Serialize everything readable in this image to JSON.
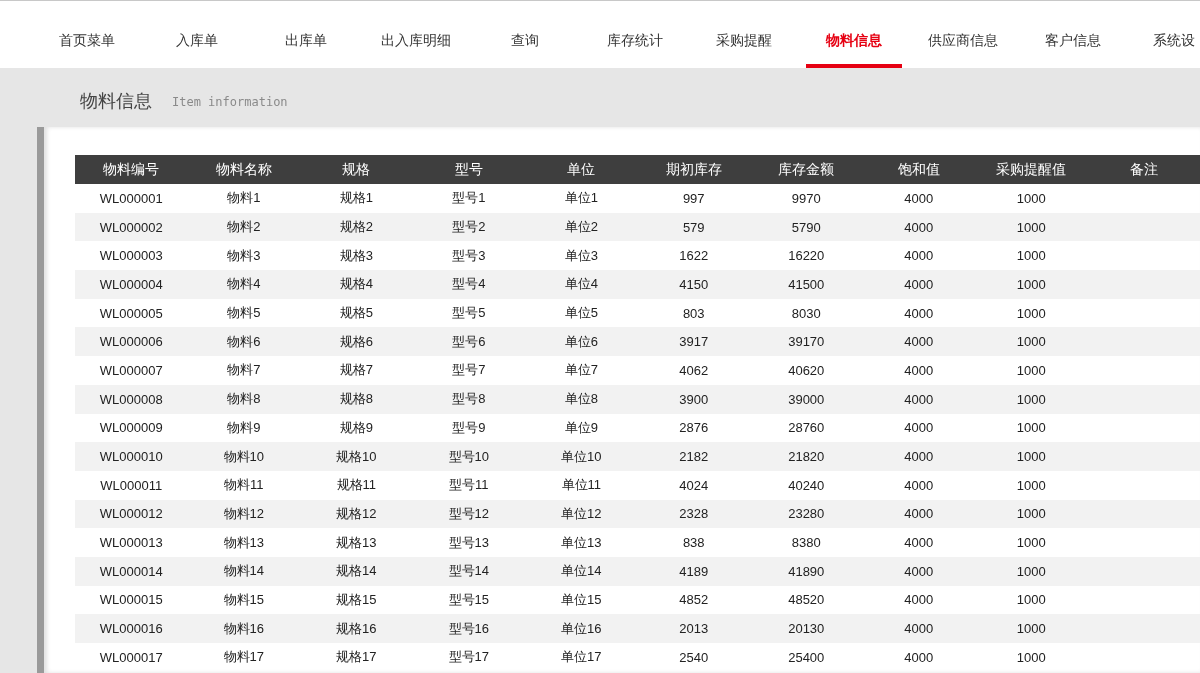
{
  "nav": {
    "items": [
      {
        "label": "首页菜单",
        "selected": false
      },
      {
        "label": "入库单",
        "selected": false
      },
      {
        "label": "出库单",
        "selected": false
      },
      {
        "label": "出入库明细",
        "selected": false
      },
      {
        "label": "查询",
        "selected": false
      },
      {
        "label": "库存统计",
        "selected": false
      },
      {
        "label": "采购提醒",
        "selected": false
      },
      {
        "label": "物料信息",
        "selected": true
      },
      {
        "label": "供应商信息",
        "selected": false
      },
      {
        "label": "客户信息",
        "selected": false
      },
      {
        "label": "系统设",
        "selected": false
      }
    ]
  },
  "page_header": {
    "title": "物料信息",
    "subtitle": "Item information"
  },
  "table": {
    "columns": [
      "物料编号",
      "物料名称",
      "规格",
      "型号",
      "单位",
      "期初库存",
      "库存金额",
      "饱和值",
      "采购提醒值",
      "备注"
    ],
    "rows": [
      [
        "WL000001",
        "物料1",
        "规格1",
        "型号1",
        "单位1",
        "997",
        "9970",
        "4000",
        "1000"
      ],
      [
        "WL000002",
        "物料2",
        "规格2",
        "型号2",
        "单位2",
        "579",
        "5790",
        "4000",
        "1000"
      ],
      [
        "WL000003",
        "物料3",
        "规格3",
        "型号3",
        "单位3",
        "1622",
        "16220",
        "4000",
        "1000"
      ],
      [
        "WL000004",
        "物料4",
        "规格4",
        "型号4",
        "单位4",
        "4150",
        "41500",
        "4000",
        "1000"
      ],
      [
        "WL000005",
        "物料5",
        "规格5",
        "型号5",
        "单位5",
        "803",
        "8030",
        "4000",
        "1000"
      ],
      [
        "WL000006",
        "物料6",
        "规格6",
        "型号6",
        "单位6",
        "3917",
        "39170",
        "4000",
        "1000"
      ],
      [
        "WL000007",
        "物料7",
        "规格7",
        "型号7",
        "单位7",
        "4062",
        "40620",
        "4000",
        "1000"
      ],
      [
        "WL000008",
        "物料8",
        "规格8",
        "型号8",
        "单位8",
        "3900",
        "39000",
        "4000",
        "1000"
      ],
      [
        "WL000009",
        "物料9",
        "规格9",
        "型号9",
        "单位9",
        "2876",
        "28760",
        "4000",
        "1000"
      ],
      [
        "WL000010",
        "物料10",
        "规格10",
        "型号10",
        "单位10",
        "2182",
        "21820",
        "4000",
        "1000"
      ],
      [
        "WL000011",
        "物料11",
        "规格11",
        "型号11",
        "单位11",
        "4024",
        "40240",
        "4000",
        "1000"
      ],
      [
        "WL000012",
        "物料12",
        "规格12",
        "型号12",
        "单位12",
        "2328",
        "23280",
        "4000",
        "1000"
      ],
      [
        "WL000013",
        "物料13",
        "规格13",
        "型号13",
        "单位13",
        "838",
        "8380",
        "4000",
        "1000"
      ],
      [
        "WL000014",
        "物料14",
        "规格14",
        "型号14",
        "单位14",
        "4189",
        "41890",
        "4000",
        "1000"
      ],
      [
        "WL000015",
        "物料15",
        "规格15",
        "型号15",
        "单位15",
        "4852",
        "48520",
        "4000",
        "1000"
      ],
      [
        "WL000016",
        "物料16",
        "规格16",
        "型号16",
        "单位16",
        "2013",
        "20130",
        "4000",
        "1000"
      ],
      [
        "WL000017",
        "物料17",
        "规格17",
        "型号17",
        "单位17",
        "2540",
        "25400",
        "4000",
        "1000"
      ]
    ]
  }
}
